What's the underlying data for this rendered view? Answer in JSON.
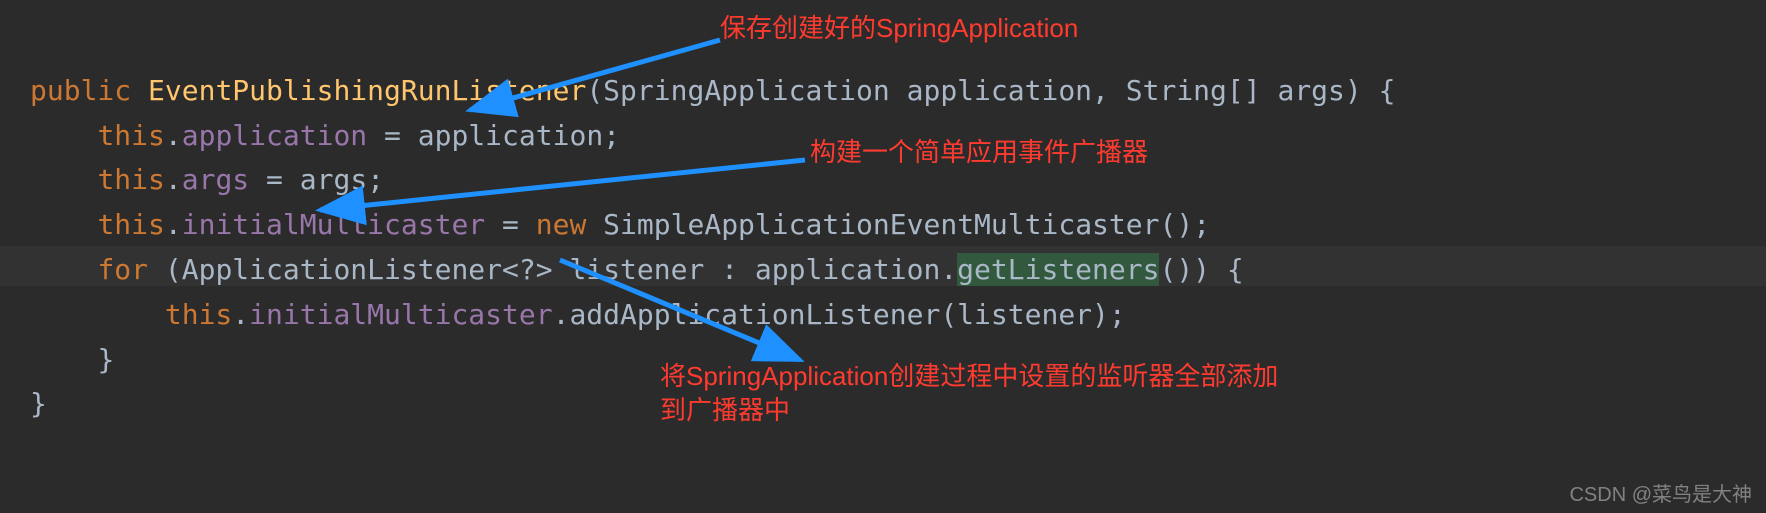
{
  "code": {
    "line1": {
      "kw_public": "public",
      "ctor": "EventPublishingRunListener",
      "sig_rest": "(SpringApplication application, String[] args) {"
    },
    "line2": {
      "kw_this": "this",
      "dot": ".",
      "field": "application",
      "rest": " = application;"
    },
    "line3": {
      "kw_this": "this",
      "dot": ".",
      "field": "args",
      "rest": " = args;"
    },
    "line4": {
      "kw_this": "this",
      "dot": ".",
      "field": "initialMulticaster",
      "eq": " = ",
      "kw_new": "new",
      "rest": " SimpleApplicationEventMulticaster();"
    },
    "line5": {
      "kw_for": "for",
      "open": " (ApplicationListener<?> listener : application.",
      "call": "getListeners",
      "close": "()) {"
    },
    "line6": {
      "kw_this": "this",
      "dot": ".",
      "field": "initialMulticaster",
      "rest": ".addApplicationListener(listener);"
    },
    "line7": {
      "brace": "}"
    },
    "line8": {
      "brace": "}"
    }
  },
  "annotations": {
    "a1": "保存创建好的SpringApplication",
    "a2": "构建一个简单应用事件广播器",
    "a3_l1": "将SpringApplication创建过程中设置的监听器全部添加",
    "a3_l2": "到广播器中"
  },
  "watermark": "CSDN @菜鸟是大神"
}
